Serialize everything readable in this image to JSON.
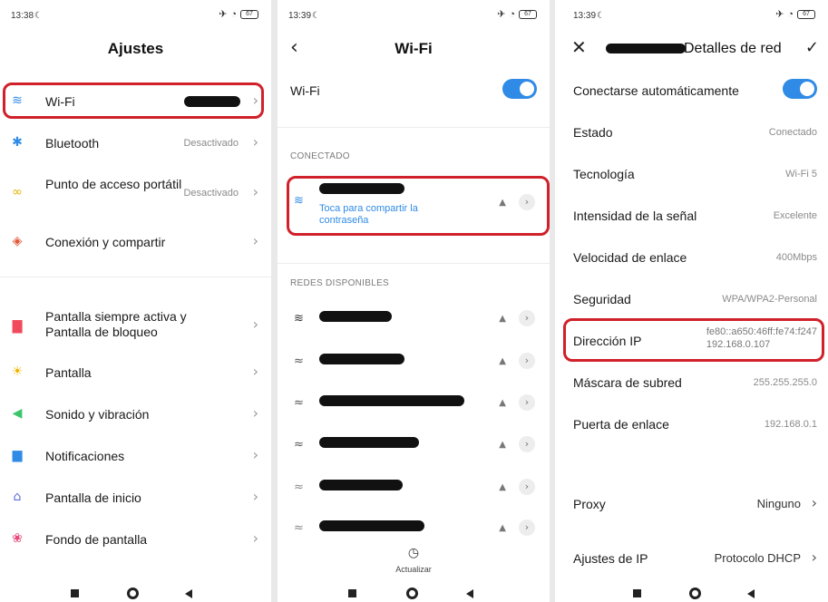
{
  "colors": {
    "accent": "#2f8be6",
    "highlight": "#d0202a"
  },
  "settings": {
    "status": {
      "time": "13:38",
      "battery": "67"
    },
    "title": "Ajustes",
    "items": [
      {
        "icon": "wifi-icon",
        "label": "Wi-Fi",
        "value": ""
      },
      {
        "icon": "bluetooth-icon",
        "label": "Bluetooth",
        "value": "Desactivado"
      },
      {
        "icon": "hotspot-icon",
        "label": "Punto de acceso portátil",
        "value": "Desactivado"
      },
      {
        "icon": "connection-sharing-icon",
        "label": "Conexión y compartir",
        "value": ""
      },
      {
        "icon": "lock-icon",
        "label": "Pantalla siempre activa y Pantalla de bloqueo",
        "value": ""
      },
      {
        "icon": "brightness-icon",
        "label": "Pantalla",
        "value": ""
      },
      {
        "icon": "sound-icon",
        "label": "Sonido y vibración",
        "value": ""
      },
      {
        "icon": "notifications-icon",
        "label": "Notificaciones",
        "value": ""
      },
      {
        "icon": "home-icon",
        "label": "Pantalla de inicio",
        "value": ""
      },
      {
        "icon": "wallpaper-icon",
        "label": "Fondo de pantalla",
        "value": ""
      }
    ]
  },
  "wifi": {
    "status": {
      "time": "13:39",
      "battery": "67"
    },
    "title": "Wi-Fi",
    "toggle_label": "Wi-Fi",
    "toggle_on": true,
    "connected_header": "CONECTADO",
    "share_text": "Toca para compartir la contraseña",
    "available_header": "REDES DISPONIBLES",
    "refresh_label": "Actualizar"
  },
  "details": {
    "status": {
      "time": "13:39",
      "battery": "67"
    },
    "title_suffix": "Detalles de red",
    "auto_connect_label": "Conectarse automáticamente",
    "auto_connect_on": true,
    "rows": [
      {
        "label": "Estado",
        "value": "Conectado"
      },
      {
        "label": "Tecnología",
        "value": "Wi-Fi 5"
      },
      {
        "label": "Intensidad de la señal",
        "value": "Excelente"
      },
      {
        "label": "Velocidad de enlace",
        "value": "400Mbps"
      },
      {
        "label": "Seguridad",
        "value": "WPA/WPA2-Personal"
      }
    ],
    "ip_label": "Dirección IP",
    "ip_v6": "fe80::a650:46ff:fe74:f247",
    "ip_v4": "192.168.0.107",
    "rows2": [
      {
        "label": "Máscara de subred",
        "value": "255.255.255.0"
      },
      {
        "label": "Puerta de enlace",
        "value": "192.168.0.1"
      }
    ],
    "proxy_label": "Proxy",
    "proxy_value": "Ninguno",
    "ipsettings_label": "Ajustes de IP",
    "ipsettings_value": "Protocolo DHCP"
  }
}
